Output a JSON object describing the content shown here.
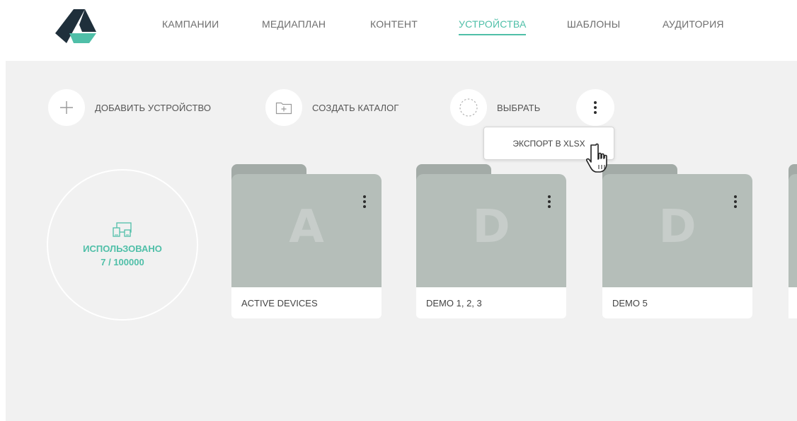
{
  "nav": {
    "items": [
      {
        "label": "КАМПАНИИ"
      },
      {
        "label": "МЕДИАПЛАН"
      },
      {
        "label": "КОНТЕНТ"
      },
      {
        "label": "УСТРОЙСТВА",
        "active": true
      },
      {
        "label": "ШАБЛОНЫ"
      },
      {
        "label": "АУДИТОРИЯ"
      }
    ]
  },
  "toolbar": {
    "add_device_label": "ДОБАВИТЬ УСТРОЙСТВО",
    "create_catalog_label": "СОЗДАТЬ КАТАЛОГ",
    "select_label": "ВЫБРАТЬ"
  },
  "dropdown": {
    "export_label": "ЭКСПОРТ В XLSX"
  },
  "usage": {
    "label": "ИСПОЛЬЗОВАНО",
    "value": "7 / 100000",
    "icon": "devices-icon"
  },
  "folders": [
    {
      "letter": "A",
      "name": "ACTIVE DEVICES"
    },
    {
      "letter": "D",
      "name": "DEMO 1, 2, 3"
    },
    {
      "letter": "D",
      "name": "DEMO 5"
    }
  ],
  "colors": {
    "accent": "#4fbfa8",
    "logo_dark": "#1f2f3b",
    "folder_body": "#b5beb9",
    "folder_tab": "#a3aba7",
    "background": "#f1f1f1"
  }
}
